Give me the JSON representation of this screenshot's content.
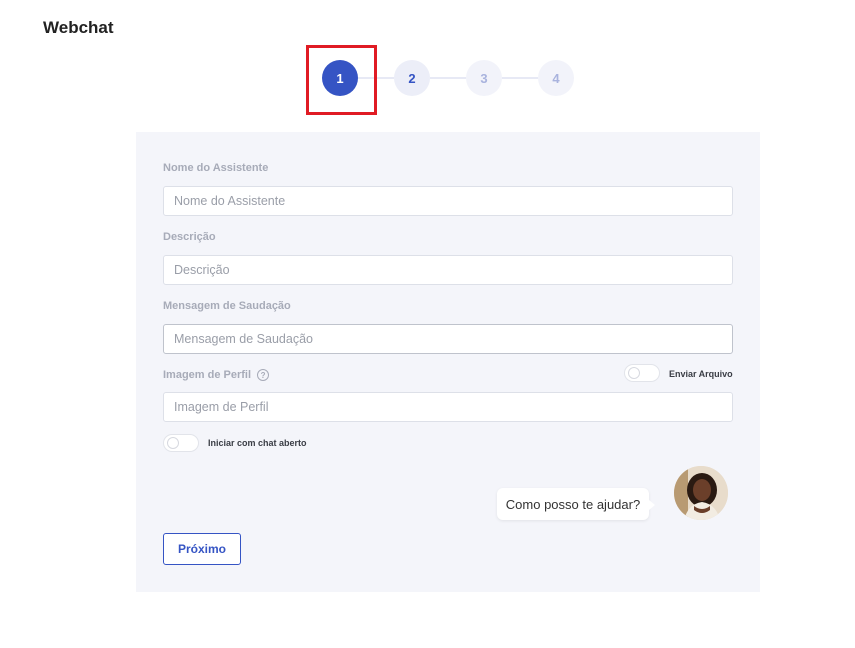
{
  "header": {
    "title": "Webchat"
  },
  "stepper": {
    "steps": [
      "1",
      "2",
      "3",
      "4"
    ],
    "current": 1
  },
  "form": {
    "assistant_name": {
      "label": "Nome do Assistente",
      "placeholder": "Nome do Assistente",
      "value": ""
    },
    "description": {
      "label": "Descrição",
      "placeholder": "Descrição",
      "value": ""
    },
    "greeting": {
      "label": "Mensagem de Saudação",
      "placeholder": "Mensagem de Saudação",
      "value": ""
    },
    "profile_image": {
      "label": "Imagem de Perfil",
      "placeholder": "Imagem de Perfil",
      "value": ""
    },
    "send_file_toggle": {
      "label": "Enviar Arquivo",
      "on": false
    },
    "open_chat_toggle": {
      "label": "Iniciar com chat aberto",
      "on": false
    }
  },
  "preview": {
    "bubble_text": "Como posso te ajudar?"
  },
  "actions": {
    "next_label": "Próximo"
  },
  "colors": {
    "primary": "#3554c4",
    "highlight": "#e01b24",
    "panel_bg": "#f4f5fa"
  }
}
